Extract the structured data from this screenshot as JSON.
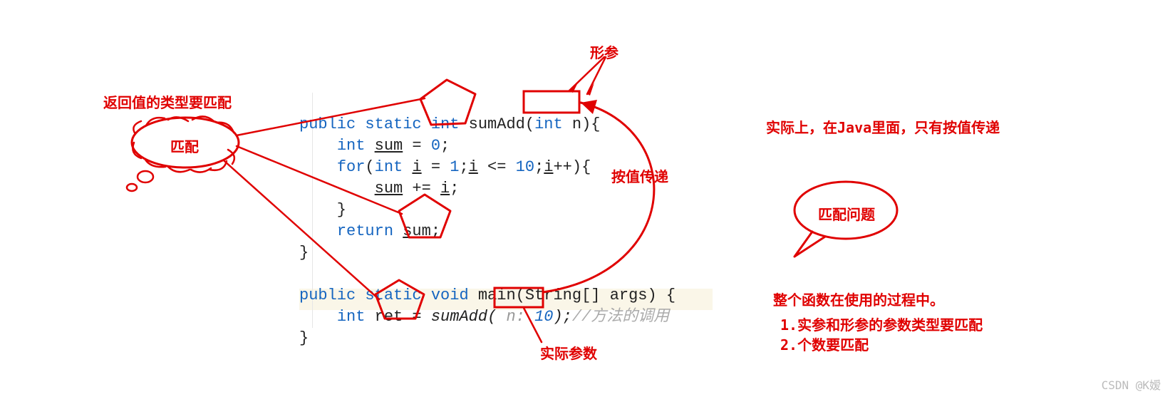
{
  "annotations": {
    "top_left_title": "返回值的类型要匹配",
    "bubble_match": "匹配",
    "formal_param_label": "形参",
    "by_value_label": "按值传递",
    "actual_param_label": "实际参数",
    "right_statement": "实际上，在Java里面，只有按值传递",
    "match_problem_bubble": "匹配问题",
    "summary_title": "整个函数在使用的过程中。",
    "summary_item1": "1.实参和形参的参数类型要匹配",
    "summary_item2": "2.个数要匹配"
  },
  "code": {
    "sig_public": "public",
    "sig_static": "static",
    "sig_int": "int",
    "method_name": "sumAdd",
    "param_type": "int",
    "param_name": "n",
    "decl_int": "int",
    "var_sum": "sum",
    "eq_zero": " = ",
    "zero": "0",
    "for_kw": "for",
    "for_cond_open": "(",
    "for_int": "int",
    "for_i": "i",
    "for_eq": " = ",
    "for_one": "1",
    "for_sep1": ";",
    "for_le": " <= ",
    "for_ten": "10",
    "for_sep2": ";",
    "for_inc": "++",
    "for_close": "){",
    "sum_plus_i": " += ",
    "semi": ";",
    "return_kw": "return",
    "main_public": "public",
    "main_static": "static",
    "main_void": "void",
    "main_name": "main",
    "main_args": "(String[] args) {",
    "ret_int": "int",
    "ret_var": "ret",
    "ret_eq": " = ",
    "call_name": "sumAdd",
    "call_hint": " n: ",
    "call_val": "10",
    "call_end": ");",
    "comment": "//方法的调用"
  },
  "footer": "CSDN @K嫒"
}
